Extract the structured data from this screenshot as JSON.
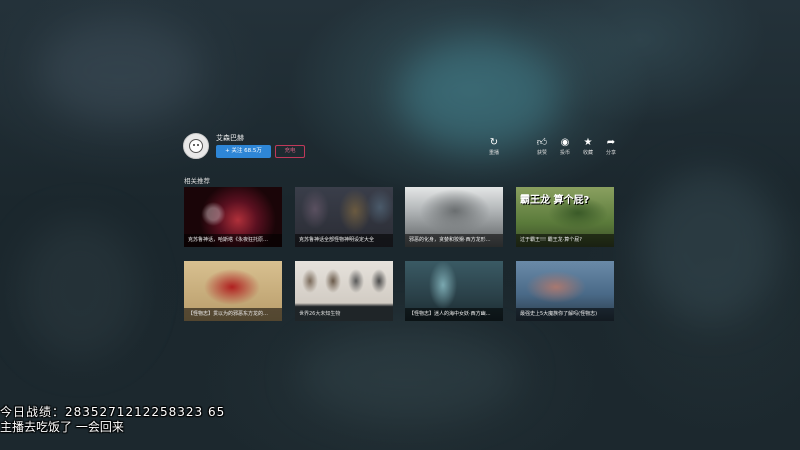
{
  "uploader": {
    "name": "艾森巴赫",
    "follow_label": "+ 关注 68.5万",
    "charge_label": "充电"
  },
  "actions": [
    {
      "icon": "replay-icon",
      "label": "重播"
    },
    {
      "icon": "like-icon",
      "label": "获赞"
    },
    {
      "icon": "coin-icon",
      "label": "投币"
    },
    {
      "icon": "star-icon",
      "label": "收藏"
    },
    {
      "icon": "share-icon",
      "label": "分享"
    }
  ],
  "section_title": "相关推荐",
  "videos": [
    {
      "title": "克苏鲁神话，哈斯塔《永夜狂托原…",
      "theme": "dark-red-vortex"
    },
    {
      "title": "克苏鲁神话全部怪物神明设定大全",
      "theme": "monster-chart"
    },
    {
      "title": "邪恶的化身，贪婪和狡猾·西方龙形…",
      "theme": "gray-dragon"
    },
    {
      "title": "过于霸王!!! 霸王龙·算个屁?",
      "theme": "green-dino",
      "overlay": "霸王龙 算个屁?"
    },
    {
      "title": "【怪物志】贯以为的邪恶东方龙的…",
      "theme": "eastern-dragon"
    },
    {
      "title": "世界26大未知生物",
      "theme": "creature-chart"
    },
    {
      "title": "【怪物志】迷人的海中女妖·西方幽…",
      "theme": "siren"
    },
    {
      "title": "最强史上5大魔族你了解吗(怪物志)",
      "theme": "shark-monster"
    }
  ],
  "danmaku": {
    "line1": "今日战绩：2835271212258323 65",
    "line2": " 主播去吃饭了 一会回来"
  }
}
